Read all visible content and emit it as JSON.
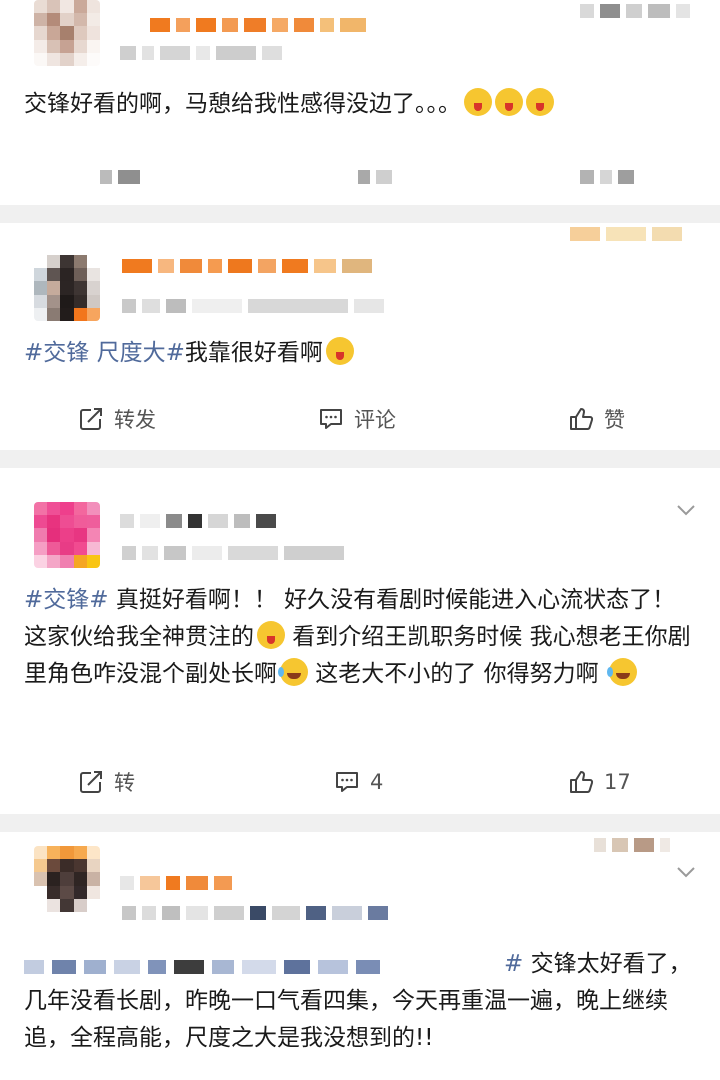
{
  "posts": [
    {
      "text": "交锋好看的啊，马憩给我性感得没边了。。。",
      "emoji_count": 3
    },
    {
      "tags": "#交锋 尺度大#",
      "text": "我靠很好看啊",
      "actions": {
        "repost": "转发",
        "comment": "评论",
        "like": "赞"
      }
    },
    {
      "tag": "#交锋#",
      "text_1": " 真挺好看啊！！ 好久没有看剧时候能进入心流状态了！ 这家伙给我全神贯注的",
      "text_2": " 看到介绍王凯职务时候 我心想老王你剧里角色咋没混个副处长啊",
      "text_3": " 这老大不小的了 你得努力啊 ",
      "actions": {
        "repost": "转",
        "comment_count": "4",
        "like_count": "17"
      }
    },
    {
      "tag_end": "#",
      "text": " 交锋太好看了，几年没看长剧，昨晚一口气看四集，今天再重温一遍，晚上继续追，全程高能，尺度之大是我没想到的!!"
    }
  ],
  "colors": {
    "tag": "#506a9b",
    "divider": "#f0f0f0",
    "action_text": "#555555"
  }
}
